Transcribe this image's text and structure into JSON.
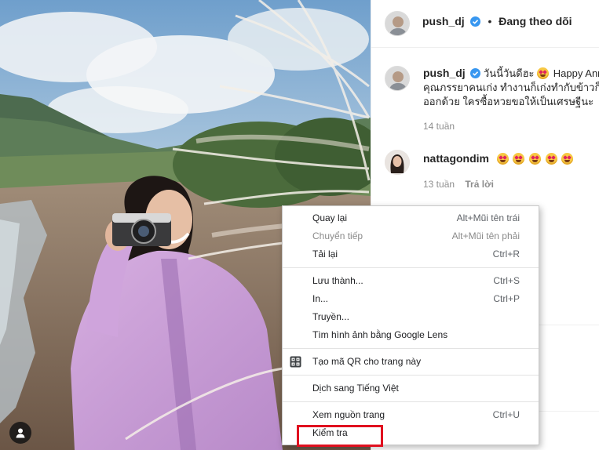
{
  "post": {
    "header": {
      "username": "push_dj",
      "separator": "•",
      "follow_status": "Đang theo dõi"
    },
    "caption": {
      "username": "push_dj",
      "line1": "วันนี้วันดีฮะ",
      "line1_suffix": "Happy Ann",
      "line2": "คุณภรรยาคนเก่ง ทำงานก็เก่งทำกับข้าวก็",
      "line3": "ออกด้วย ใครซื้อหวยขอให้เป็นเศรษฐีนะ",
      "time": "14 tuần"
    },
    "comments": [
      {
        "username": "nattagondim",
        "emoji_count": 5,
        "emoji_name": "heart-eyes-emoji",
        "time": "13 tuần",
        "reply_label": "Trả lời"
      }
    ]
  },
  "context_menu": {
    "groups": [
      [
        {
          "label": "Quay lại",
          "shortcut": "Alt+Mũi tên trái",
          "enabled": true
        },
        {
          "label": "Chuyển tiếp",
          "shortcut": "Alt+Mũi tên phải",
          "enabled": false
        },
        {
          "label": "Tải lại",
          "shortcut": "Ctrl+R",
          "enabled": true
        }
      ],
      [
        {
          "label": "Lưu thành...",
          "shortcut": "Ctrl+S",
          "enabled": true
        },
        {
          "label": "In...",
          "shortcut": "Ctrl+P",
          "enabled": true
        },
        {
          "label": "Truyền...",
          "shortcut": "",
          "enabled": true
        },
        {
          "label": "Tìm hình ảnh bằng Google Lens",
          "shortcut": "",
          "enabled": true
        }
      ],
      [
        {
          "label": "Tạo mã QR cho trang này",
          "shortcut": "",
          "enabled": true,
          "icon": "qr-code-icon"
        }
      ],
      [
        {
          "label": "Dịch sang Tiếng Việt",
          "shortcut": "",
          "enabled": true
        }
      ],
      [
        {
          "label": "Xem nguồn trang",
          "shortcut": "Ctrl+U",
          "enabled": true
        },
        {
          "label": "Kiểm tra",
          "shortcut": "",
          "enabled": true
        }
      ]
    ],
    "highlighted_item": "Kiểm tra",
    "highlight_color": "#e0101f"
  },
  "colors": {
    "verified_badge": "#3897f0",
    "text_primary": "#262626",
    "text_secondary": "#8e8e8e"
  }
}
